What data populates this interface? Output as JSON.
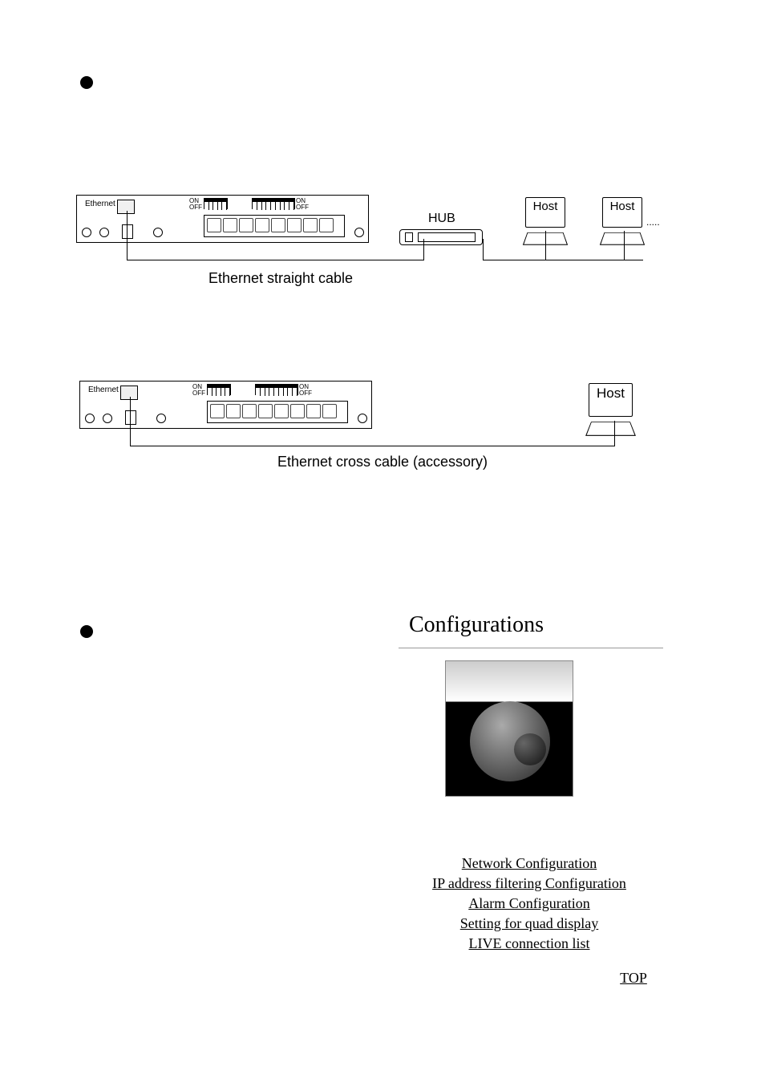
{
  "bullets": {
    "top1": true,
    "top2": true
  },
  "labels": {
    "ethernet": "Ethernet",
    "on": "ON",
    "off": "OFF",
    "hub": "HUB",
    "host": "Host",
    "dots": "....."
  },
  "captions": {
    "straight": "Ethernet straight cable",
    "cross": "Ethernet cross cable (accessory)"
  },
  "config": {
    "title": "Configurations",
    "links": {
      "network": "Network Configuration",
      "ipfilter": "IP address filtering Configuration",
      "alarm": "Alarm Configuration",
      "quad": "Setting for quad display",
      "live": "LIVE connection list",
      "top": "TOP"
    }
  }
}
